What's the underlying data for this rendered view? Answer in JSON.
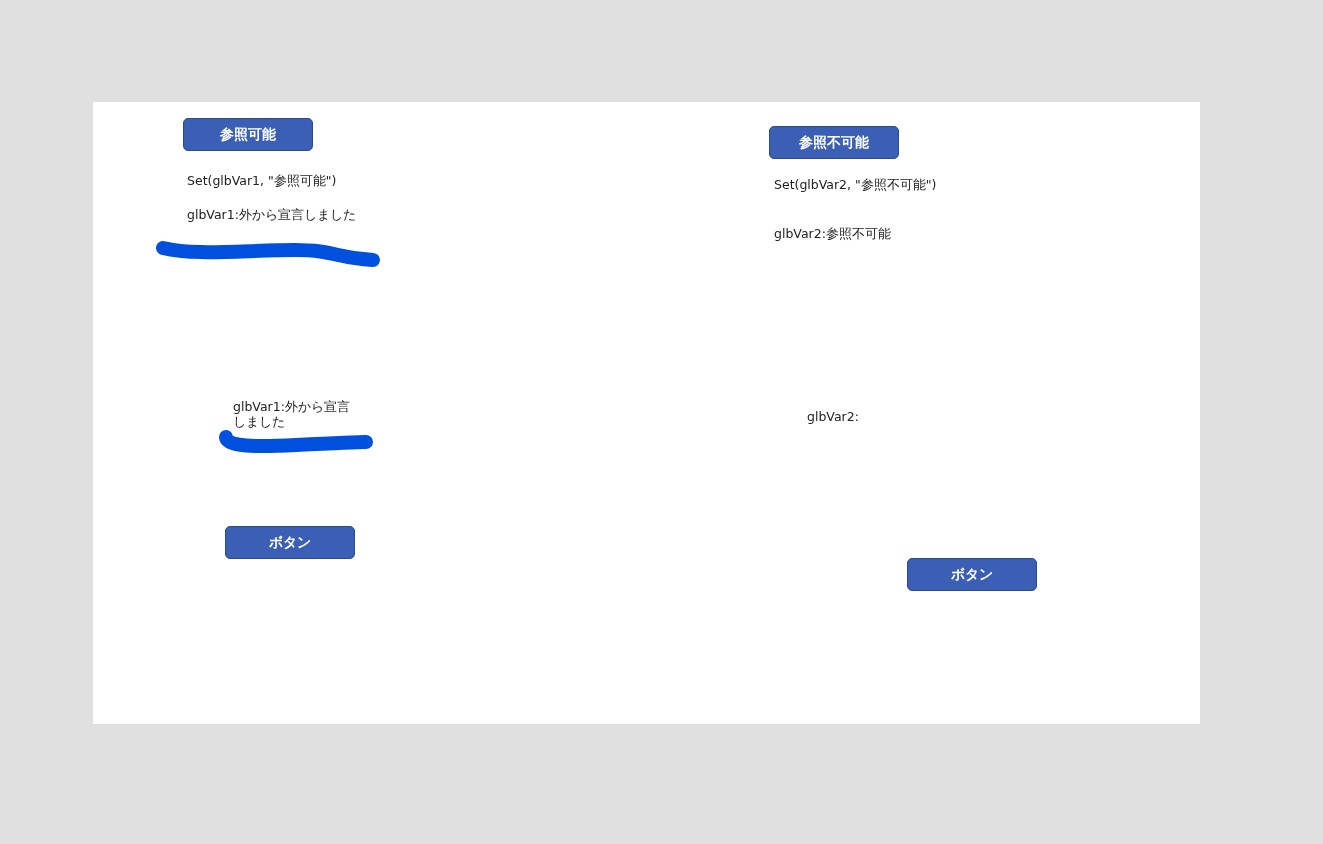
{
  "controls": [
    {
      "kind": "button",
      "text": "参照可能"
    },
    {
      "kind": "label",
      "text": "Set(glbVar1, \"参照可能\")"
    },
    {
      "kind": "label",
      "text": "glbVar1:外から宣言しました"
    },
    {
      "kind": "label",
      "text": "glbVar1:外から宣言しました"
    },
    {
      "kind": "button",
      "text": "ボタン"
    },
    {
      "kind": "button",
      "text": "参照不可能"
    },
    {
      "kind": "label",
      "text": "Set(glbVar2, \"参照不可能\")"
    },
    {
      "kind": "label",
      "text": "glbVar2:参照不可能"
    },
    {
      "kind": "label",
      "text": "glbVar2:"
    },
    {
      "kind": "button",
      "text": "ボタン"
    }
  ]
}
